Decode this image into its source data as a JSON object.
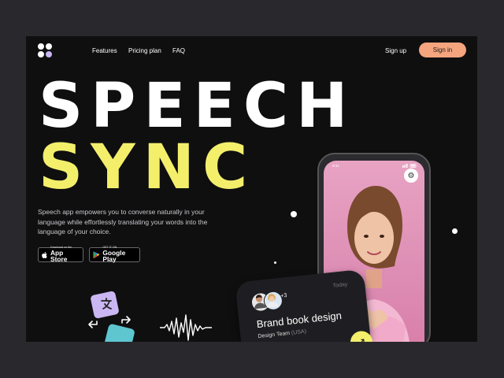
{
  "header": {
    "nav": [
      "Features",
      "Pricing plan",
      "FAQ"
    ],
    "sign_up": "Sign up",
    "sign_in": "Sign in"
  },
  "hero": {
    "title_line1": "SPEECH",
    "title_line2": "SYNC",
    "description": "Speech app empowers you to converse naturally in your language while effortlessly translating your words into the language of your choice."
  },
  "stores": {
    "apple_small": "Download on the",
    "apple_big": "App Store",
    "google_small": "GET IT ON",
    "google_big": "Google Play"
  },
  "phone": {
    "time": "9:41"
  },
  "card": {
    "extra_count": "+3",
    "date": "Today",
    "title": "Brand book design",
    "team": "Design Team",
    "region": "(USA)"
  },
  "colors": {
    "accent_yellow": "#f3ef6b",
    "accent_peach": "#f4a57e",
    "accent_purple": "#c9b6f2",
    "accent_teal": "#5ec6cf",
    "background": "#0f0f10"
  },
  "icons": [
    "logo-icon",
    "apple-icon",
    "google-play-icon",
    "gear-icon",
    "arrow-up-right-icon",
    "translate-icon",
    "soundwave-icon"
  ]
}
